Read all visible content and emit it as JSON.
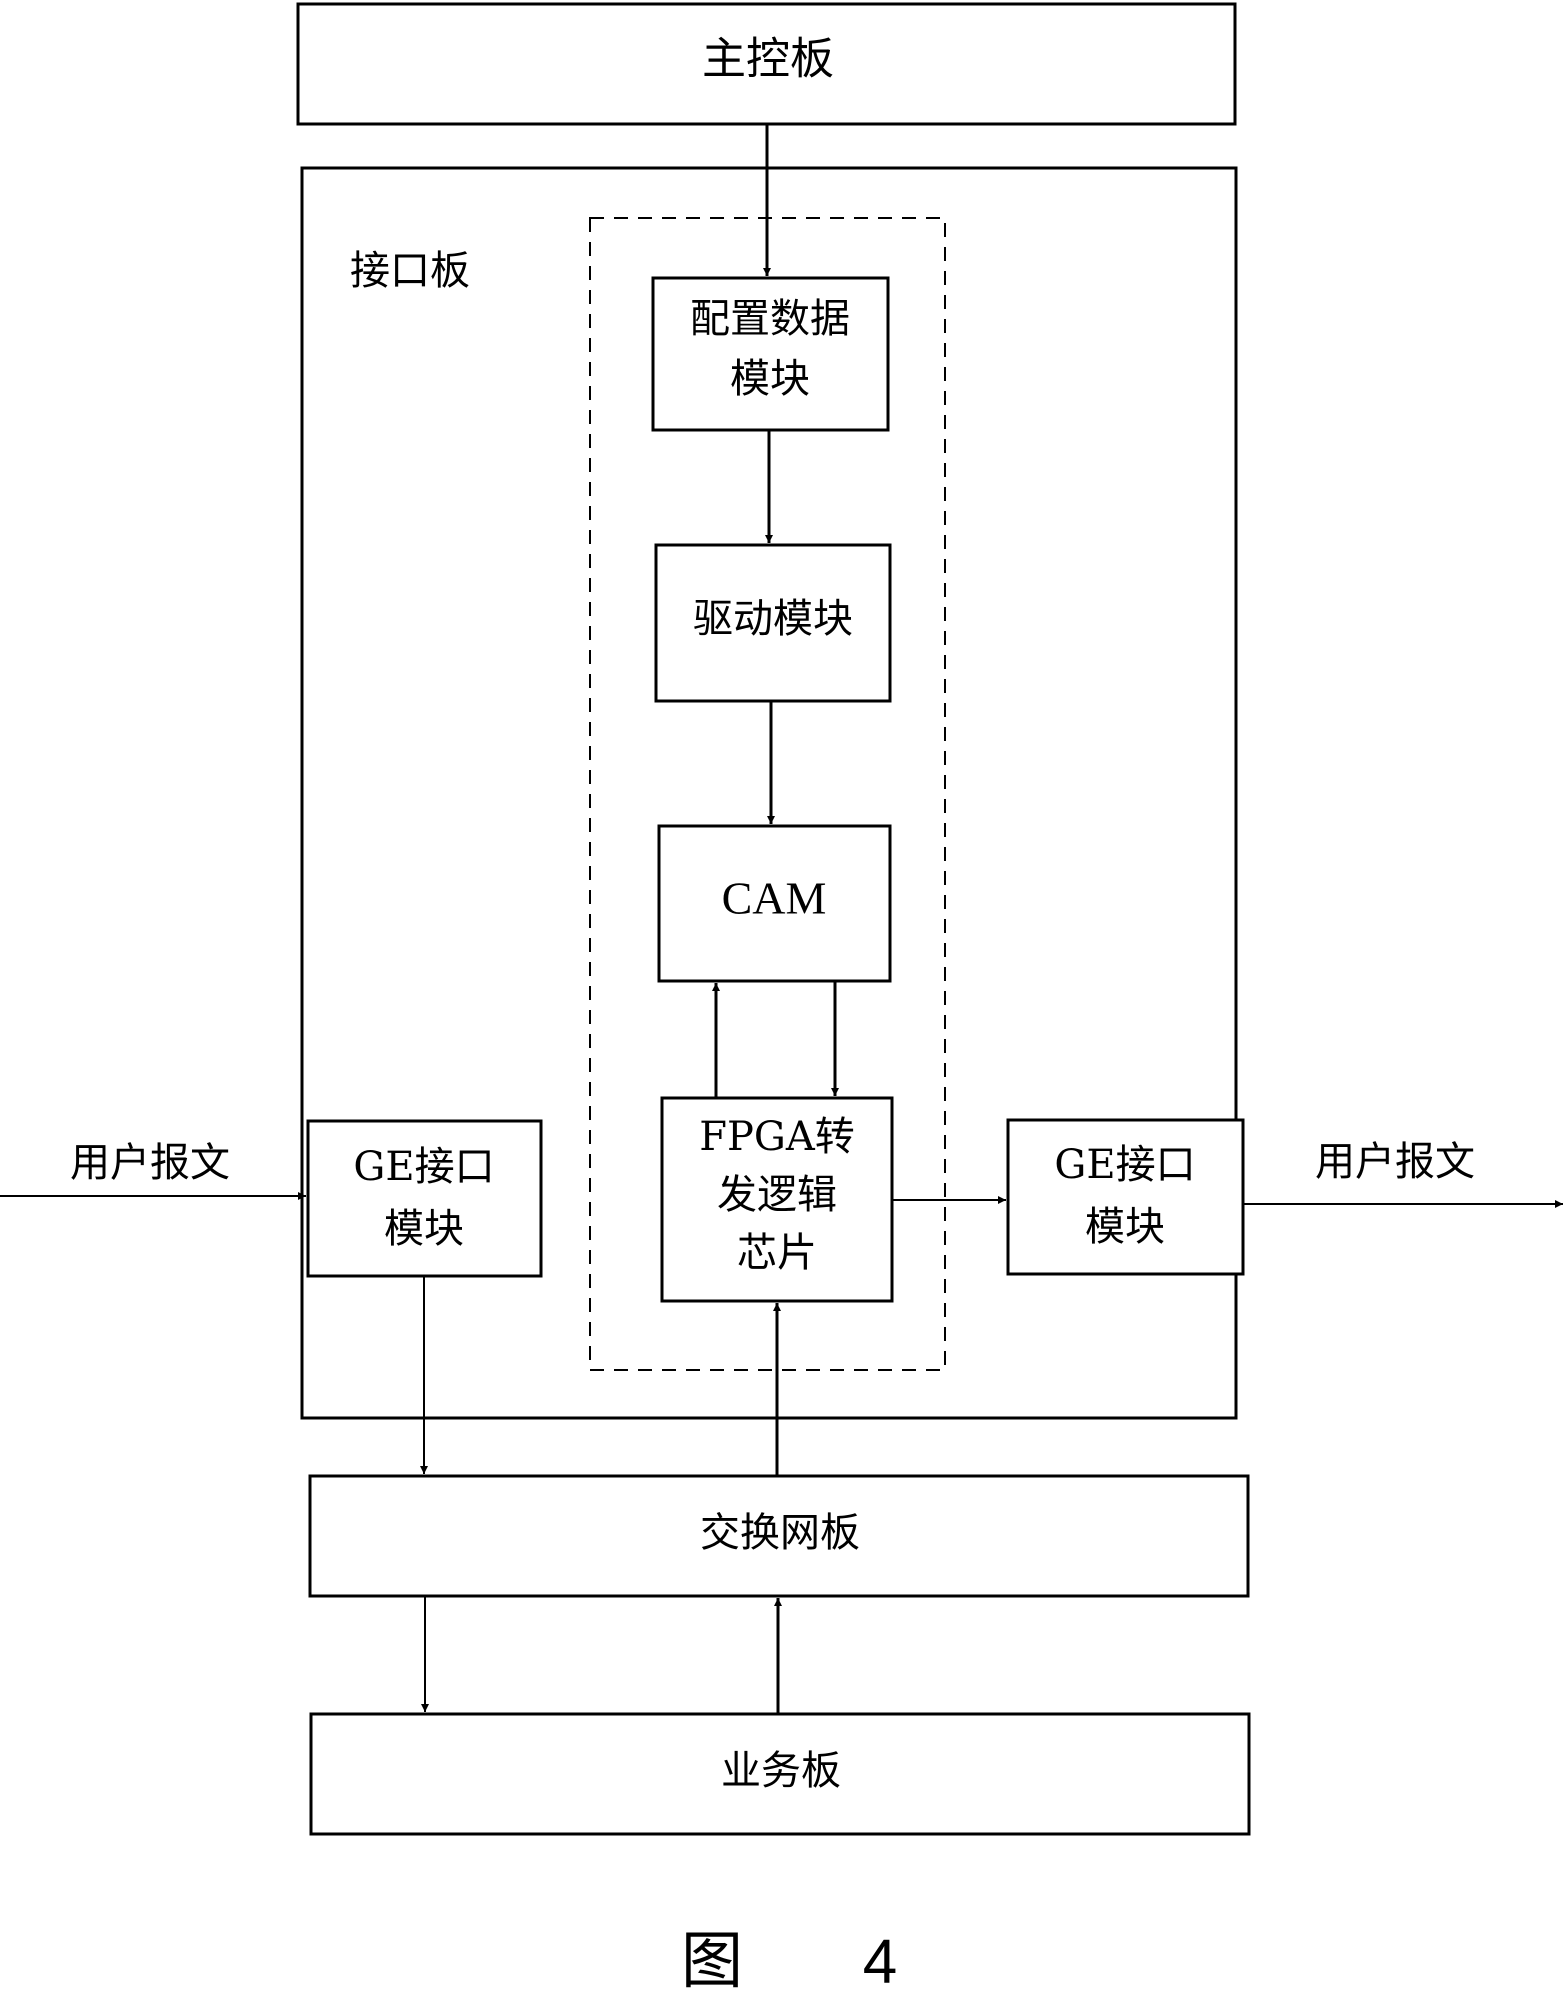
{
  "figure": {
    "caption_prefix": "图",
    "caption_number": "4"
  },
  "blocks": {
    "main_control_board": "主控板",
    "interface_board": "接口板",
    "config_data_module": [
      "配置数据",
      "模块"
    ],
    "driver_module": "驱动模块",
    "cam": "CAM",
    "fpga_chip": [
      "FPGA转",
      "发逻辑",
      "芯片"
    ],
    "ge_interface_left": [
      "GE接口",
      "模块"
    ],
    "ge_interface_right": [
      "GE接口",
      "模块"
    ],
    "switch_fabric_board": "交换网板",
    "service_board": "业务板"
  },
  "edges": {
    "input_label": "用户报文",
    "output_label": "用户报文"
  }
}
